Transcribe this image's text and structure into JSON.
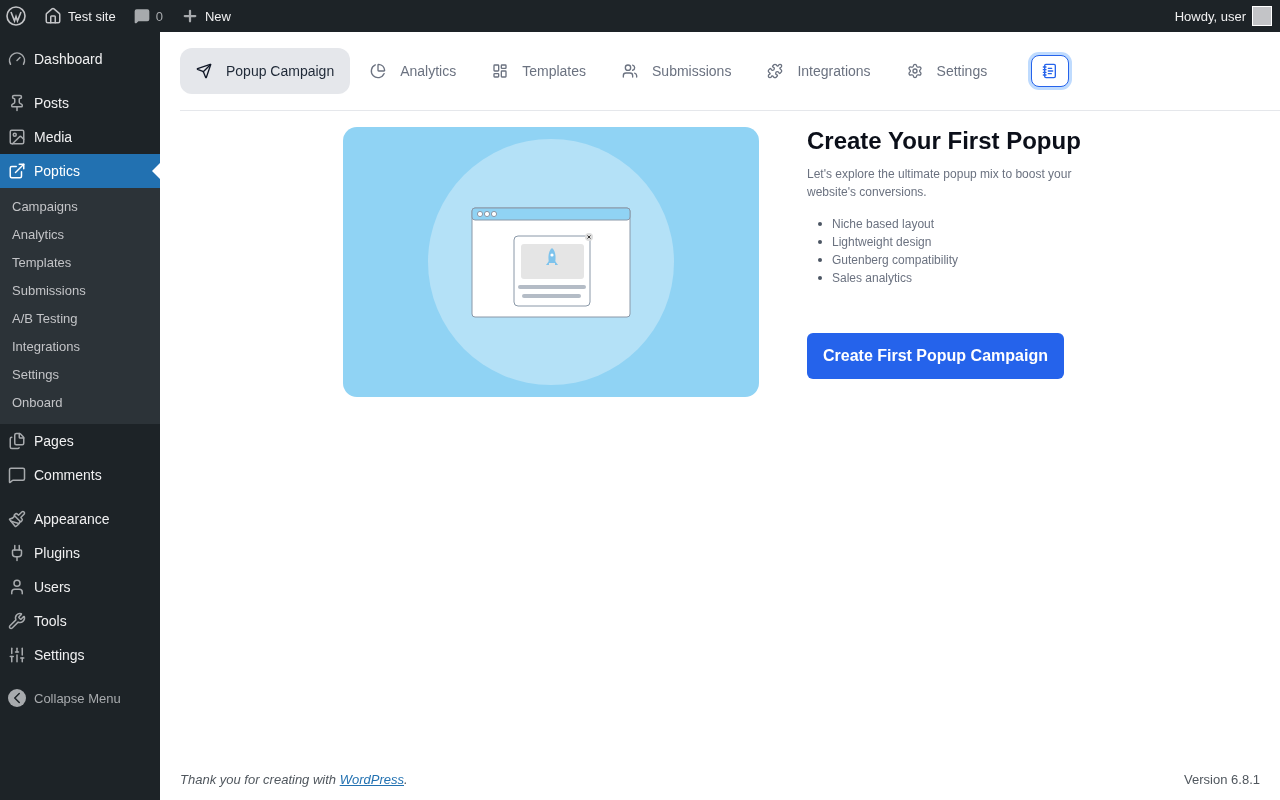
{
  "admin_bar": {
    "site": "Test site",
    "comments": "0",
    "new": "New",
    "greeting": "Howdy, user"
  },
  "sidebar": {
    "groups": [
      [
        {
          "label": "Dashboard",
          "selected": false
        }
      ],
      [
        {
          "label": "Posts",
          "selected": false
        },
        {
          "label": "Media",
          "selected": false
        },
        {
          "label": "Poptics",
          "selected": true,
          "children": [
            "Campaigns",
            "Analytics",
            "Templates",
            "Submissions",
            "A/B Testing",
            "Integrations",
            "Settings",
            "Onboard"
          ]
        },
        {
          "label": "Pages",
          "selected": false
        },
        {
          "label": "Comments",
          "selected": false
        }
      ],
      [
        {
          "label": "Appearance",
          "selected": false
        },
        {
          "label": "Plugins",
          "selected": false
        },
        {
          "label": "Users",
          "selected": false
        },
        {
          "label": "Tools",
          "selected": false
        },
        {
          "label": "Settings",
          "selected": false
        }
      ]
    ],
    "collapse": "Collapse Menu"
  },
  "tabs": [
    {
      "label": "Popup Campaign",
      "selected": true
    },
    {
      "label": "Analytics",
      "selected": false
    },
    {
      "label": "Templates",
      "selected": false
    },
    {
      "label": "Submissions",
      "selected": false
    },
    {
      "label": "Integrations",
      "selected": false
    },
    {
      "label": "Settings",
      "selected": false
    }
  ],
  "hero": {
    "title": "Create Your First Popup",
    "description": "Let's explore the ultimate popup mix to boost your website's conversions.",
    "features": [
      "Niche based layout",
      "Lightweight design",
      "Gutenberg compatibility",
      "Sales analytics"
    ],
    "button": "Create First Popup Campaign"
  },
  "footer": {
    "text_before": "Thank you for creating with",
    "link": "WordPress",
    "text_after": ".",
    "version": "Version 6.8.1"
  }
}
